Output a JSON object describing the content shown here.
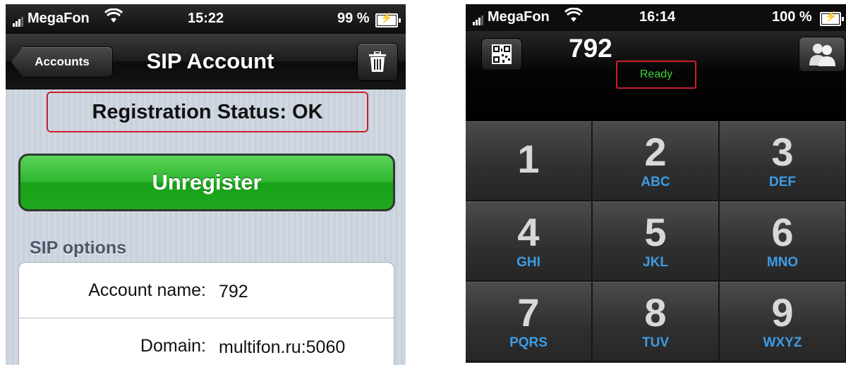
{
  "left": {
    "status": {
      "carrier": "MegaFon",
      "time": "15:22",
      "battery": "99 %"
    },
    "nav": {
      "back_label": "Accounts",
      "title": "SIP Account"
    },
    "registration_status": "Registration Status: OK",
    "unregister_label": "Unregister",
    "section_title": "SIP options",
    "options": [
      {
        "label": "Account name:",
        "value": "792"
      },
      {
        "label": "Domain:",
        "value": "multifon.ru:5060"
      }
    ]
  },
  "right": {
    "status": {
      "carrier": "MegaFon",
      "time": "16:14",
      "battery": "100 %"
    },
    "dialed_number": "792",
    "state": "Ready",
    "keys": [
      {
        "digit": "1",
        "letters": ""
      },
      {
        "digit": "2",
        "letters": "ABC"
      },
      {
        "digit": "3",
        "letters": "DEF"
      },
      {
        "digit": "4",
        "letters": "GHI"
      },
      {
        "digit": "5",
        "letters": "JKL"
      },
      {
        "digit": "6",
        "letters": "MNO"
      },
      {
        "digit": "7",
        "letters": "PQRS"
      },
      {
        "digit": "8",
        "letters": "TUV"
      },
      {
        "digit": "9",
        "letters": "WXYZ"
      }
    ]
  },
  "colors": {
    "highlight_red": "#c8202a",
    "green_button": "#1ea81e",
    "ready_green": "#3bd23b",
    "key_letters_blue": "#3c9ce6"
  },
  "icons": [
    "signal-bars-icon",
    "wifi-icon",
    "battery-charging-icon",
    "trash-icon",
    "qr-code-icon",
    "contacts-icon"
  ]
}
